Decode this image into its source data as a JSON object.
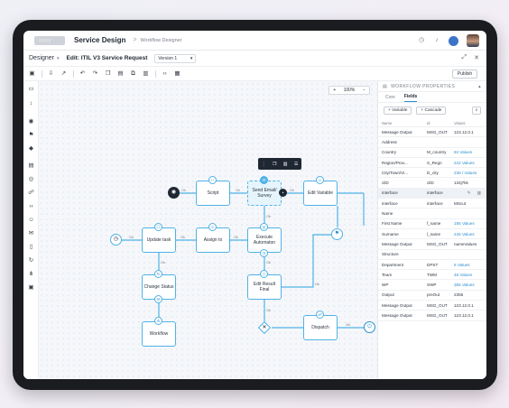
{
  "header": {
    "logo_text": "▯▯▯▯",
    "title": "Service Design",
    "crumb_sep": ">",
    "breadcrumb": "Workflow Designer"
  },
  "subbar": {
    "designer": "Designer",
    "edit_title": "Edit: ITIL V3 Service Request",
    "version": "Version 1"
  },
  "toolbar": {
    "publish": "Publish"
  },
  "canvas": {
    "zoom": "100%",
    "zoom_minus": "−",
    "zoom_plus": "+",
    "nodes": {
      "script": "Script",
      "send_email": "Send Email/ Survey",
      "edit_variable": "Edit Variable",
      "update_task": "Update task",
      "assign_to": "Assign to",
      "execute_automation": "Execute Automaton",
      "change_status": "Change Status",
      "edit_result": "Edit Result Final",
      "workflow": "Workflow",
      "dispatch": "Dispatch"
    },
    "edge_label": "Ok"
  },
  "panel": {
    "title": "WORKFLOW PROPERTIES",
    "tabs": [
      "Core",
      "Fields"
    ],
    "active_tab": "Fields",
    "add_variable": "+ Variable",
    "add_cascade": "+ Cascade",
    "columns": [
      "Name",
      "Id",
      "Values"
    ],
    "rows": [
      {
        "name": "Message Output",
        "id": "MSG_OUT",
        "value": "123.12.0.1",
        "link": false
      },
      {
        "name": "  Address",
        "id": "",
        "value": "",
        "link": false
      },
      {
        "name": "  Country",
        "id": "M_country",
        "value": "84 Values",
        "link": true
      },
      {
        "name": "  Region/Prov...",
        "id": "S_Regn",
        "value": "242 Values",
        "link": true
      },
      {
        "name": "  City/Town/Vi...",
        "id": "D_city",
        "value": "236 / Values",
        "link": true
      },
      {
        "name": "cilD",
        "id": "cilD",
        "value": "134j7kk",
        "link": false
      },
      {
        "name": "interface",
        "id": "interface",
        "value": "",
        "link": false,
        "hl": true
      },
      {
        "name": "interface",
        "id": "interface",
        "value": "MScut",
        "link": false
      },
      {
        "name": "  Name",
        "id": "",
        "value": "",
        "link": false
      },
      {
        "name": "  First Name",
        "id": "f_name",
        "value": "185 Values",
        "link": true
      },
      {
        "name": "  Surname",
        "id": "l_name",
        "value": "245 Values",
        "link": true
      },
      {
        "name": "Message Output",
        "id": "MSG_OUT",
        "value": "nameValues",
        "link": false
      },
      {
        "name": "  Structure",
        "id": "",
        "value": "",
        "link": false
      },
      {
        "name": "  Department",
        "id": "DPST",
        "value": "6 Values",
        "link": true
      },
      {
        "name": "  Team",
        "id": "TWM",
        "value": "48 Values",
        "link": true
      },
      {
        "name": "  WP",
        "id": "SWP",
        "value": "356 Values",
        "link": true
      },
      {
        "name": "Output",
        "id": "preOut",
        "value": "2355",
        "link": false
      },
      {
        "name": "Message Output",
        "id": "MSG_OUT",
        "value": "123.12.0.1",
        "link": false
      },
      {
        "name": "Message Output",
        "id": "MSG_OUT",
        "value": "123.12.0.1",
        "link": false
      }
    ]
  }
}
